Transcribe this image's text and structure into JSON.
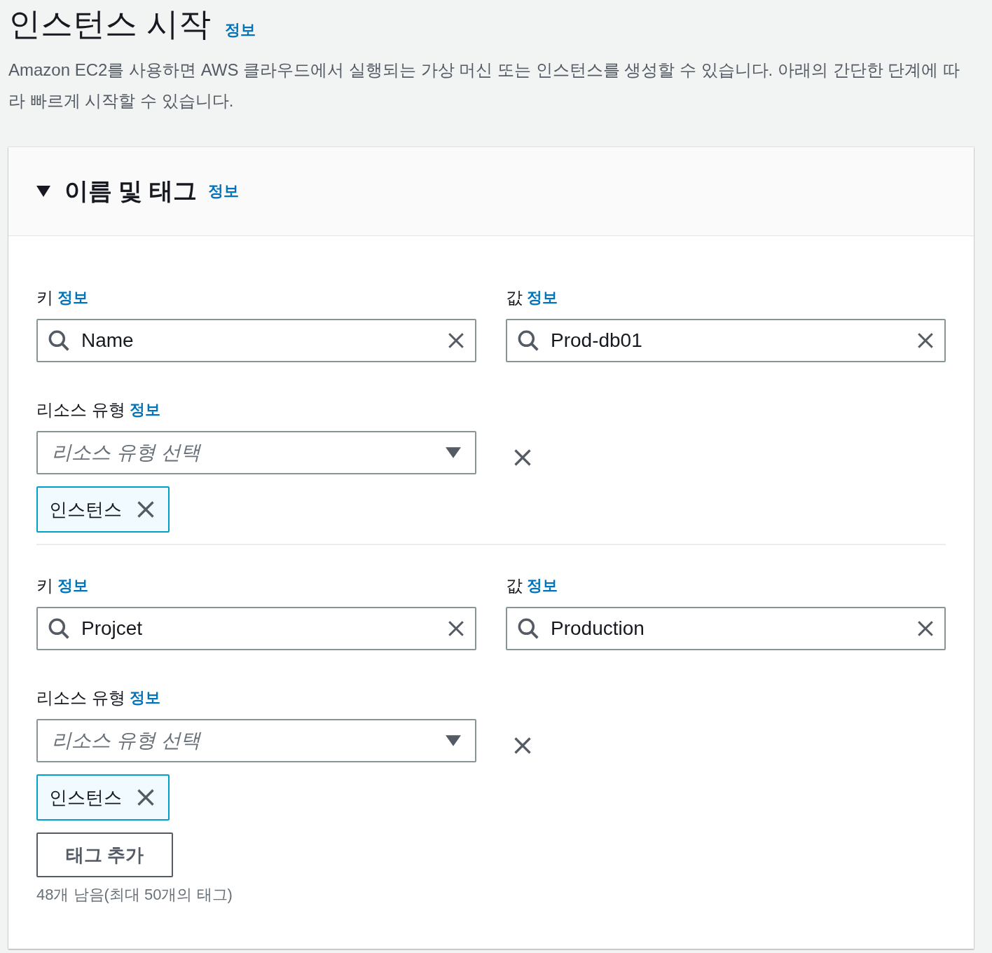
{
  "page": {
    "title": "인스턴스 시작",
    "info_link": "정보",
    "description": "Amazon EC2를 사용하면 AWS 클라우드에서 실행되는 가상 머신 또는 인스턴스를 생성할 수 있습니다. 아래의 간단한 단계에 따라 빠르게 시작할 수 있습니다."
  },
  "section": {
    "title": "이름 및 태그",
    "info_link": "정보",
    "expanded": true,
    "tags": [
      {
        "key_label": "키",
        "key_info": "정보",
        "key": "Name",
        "value_label": "값",
        "value_info": "정보",
        "value": "Prod-db01",
        "resource_label": "리소스 유형",
        "resource_info": "정보",
        "resource_placeholder": "리소스 유형 선택",
        "resource_tokens": [
          "인스턴스"
        ]
      },
      {
        "key_label": "키",
        "key_info": "정보",
        "key": "Projcet",
        "value_label": "값",
        "value_info": "정보",
        "value": "Production",
        "resource_label": "리소스 유형",
        "resource_info": "정보",
        "resource_placeholder": "리소스 유형 선택",
        "resource_tokens": [
          "인스턴스"
        ]
      }
    ],
    "add_button": "태그 추가",
    "remaining": "48개 남음(최대 50개의 태그)"
  }
}
